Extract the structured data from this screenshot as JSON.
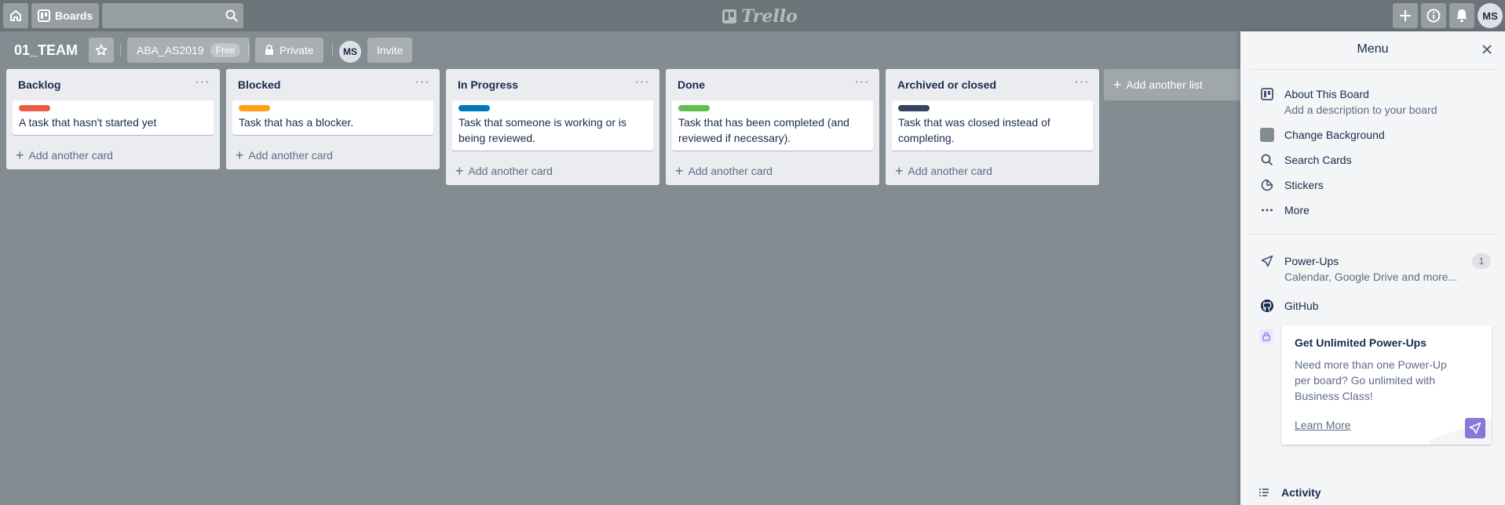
{
  "header": {
    "boards_label": "Boards",
    "search": {
      "value": "",
      "placeholder": ""
    },
    "logo_text": "Trello",
    "user_initials": "MS"
  },
  "board": {
    "title": "01_TEAM",
    "team_name": "ABA_AS2019",
    "team_badge": "Free",
    "visibility": "Private",
    "member_initials": "MS",
    "invite_label": "Invite"
  },
  "lists": [
    {
      "title": "Backlog",
      "menu": "···",
      "cards": [
        {
          "title": "A task that hasn't started yet",
          "label_color": "#eb5a46"
        }
      ],
      "add_card": "Add another card"
    },
    {
      "title": "Blocked",
      "menu": "···",
      "cards": [
        {
          "title": "Task that has a blocker.",
          "label_color": "#ff9f1a"
        }
      ],
      "add_card": "Add another card"
    },
    {
      "title": "In Progress",
      "menu": "···",
      "cards": [
        {
          "title": "Task that someone is working or is being reviewed.",
          "label_color": "#0079bf"
        }
      ],
      "add_card": "Add another card"
    },
    {
      "title": "Done",
      "menu": "···",
      "cards": [
        {
          "title": "Task that has been completed (and reviewed if necessary).",
          "label_color": "#61bd4f"
        }
      ],
      "add_card": "Add another card"
    },
    {
      "title": "Archived or closed",
      "menu": "···",
      "cards": [
        {
          "title": "Task that was closed instead of completing.",
          "label_color": "#344563"
        }
      ],
      "add_card": "Add another card"
    }
  ],
  "add_list": "Add another list",
  "menu": {
    "title": "Menu",
    "about": {
      "label": "About This Board",
      "sub": "Add a description to your board"
    },
    "change_background": "Change Background",
    "search_cards": "Search Cards",
    "stickers": "Stickers",
    "more": "More",
    "power_ups": {
      "label": "Power-Ups",
      "sub": "Calendar, Google Drive and more...",
      "badge": "1"
    },
    "github": "GitHub",
    "promo": {
      "title": "Get Unlimited Power-Ups",
      "body": "Need more than one Power-Up per board? Go unlimited with Business Class!",
      "link": "Learn More"
    },
    "activity": "Activity"
  }
}
